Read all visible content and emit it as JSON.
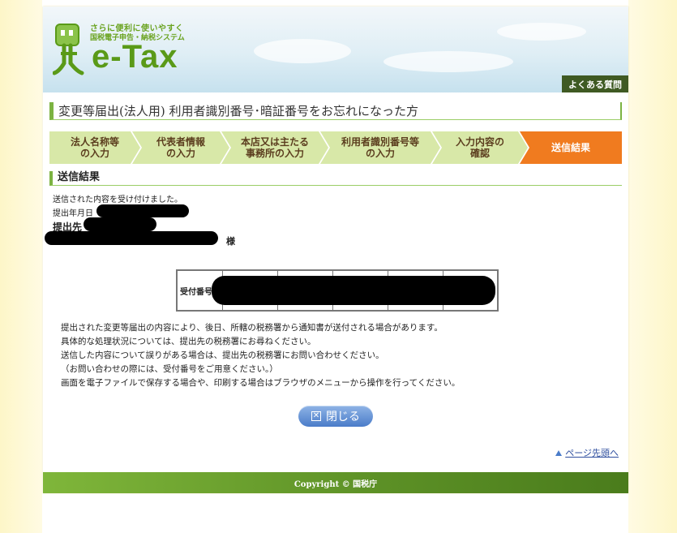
{
  "header": {
    "tagline1": "さらに便利に使いやすく",
    "tagline2": "国税電子申告・納税システム",
    "logo_text": "e-Tax",
    "faq_label": "よくある質問"
  },
  "page_title": "変更等届出(法人用)  利用者識別番号･暗証番号をお忘れになった方",
  "steps": [
    {
      "line1": "法人名称等",
      "line2": "の入力"
    },
    {
      "line1": "代表者情報",
      "line2": "の入力"
    },
    {
      "line1": "本店又は主たる",
      "line2": "事務所の入力"
    },
    {
      "line1": "利用者識別番号等",
      "line2": "の入力"
    },
    {
      "line1": "入力内容の",
      "line2": "確認"
    },
    {
      "line1": "送信結果",
      "line2": ""
    }
  ],
  "section_title": "送信結果",
  "result": {
    "accepted": "送信された内容を受け付けました。",
    "date_label": "提出年月日",
    "dest_label": "提出先",
    "honorific": "様"
  },
  "receipt": {
    "label": "受付番号"
  },
  "notes": [
    "提出された変更等届出の内容により、後日、所轄の税務署から通知書が送付される場合があります。",
    "具体的な処理状況については、提出先の税務署にお尋ねください。",
    "送信した内容について誤りがある場合は、提出先の税務署にお問い合わせください。",
    "（お問い合わせの際には、受付番号をご用意ください。）",
    "画面を電子ファイルで保存する場合や、印刷する場合はブラウザのメニューから操作を行ってください。"
  ],
  "close_label": "閉じる",
  "page_top_label": "ページ先頭へ",
  "footer": "Copyright © 国税庁",
  "colors": {
    "brand_green": "#5a9a18",
    "active_step": "#f07b1f",
    "button_blue": "#4a7cc9"
  }
}
